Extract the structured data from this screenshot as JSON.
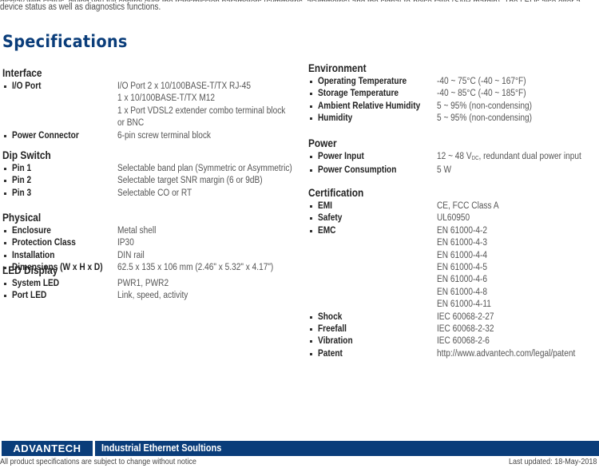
{
  "intro": {
    "line_cut": "display with status, giving you full control over the transmission parameters (symmetric, asymmetric) and the signal-to-noise ratio (SNR margin). The LEDs also offer a quick view of the",
    "line_2": "device status as well as diagnostics functions."
  },
  "title": "Specifications",
  "left_sections": [
    {
      "title": "Interface",
      "rows": [
        {
          "label": "I/O Port",
          "values": [
            "I/O Port 2 x 10/100BASE-T/TX RJ-45",
            "1 x 10/100BASE-T/TX M12",
            "1 x Port VDSL2 extender combo terminal block",
            "or BNC"
          ]
        },
        {
          "label": "Power Connector",
          "values": [
            "6-pin screw terminal block"
          ]
        }
      ]
    },
    {
      "title": "Dip Switch",
      "rows": [
        {
          "label": "Pin 1",
          "values": [
            "Selectable band plan (Symmetric or Asymmetric)"
          ]
        },
        {
          "label": "Pin 2",
          "values": [
            "Selectable target SNR margin (6 or 9dB)"
          ]
        },
        {
          "label": "Pin 3",
          "values": [
            "Selectable CO or RT"
          ]
        }
      ]
    },
    {
      "title": "Physical",
      "rows": [
        {
          "label": "Enclosure",
          "values": [
            "Metal shell"
          ]
        },
        {
          "label": "Protection Class",
          "values": [
            "IP30"
          ]
        },
        {
          "label": "Installation",
          "values": [
            "DIN rail"
          ]
        },
        {
          "label": "Dimensions (W x H x D)",
          "values": [
            "62.5 x 135 x 106 mm (2.46\" x 5.32\" x 4.17\")"
          ]
        }
      ]
    },
    {
      "title": "LED Display",
      "rows": [
        {
          "label": "System LED",
          "values": [
            "PWR1, PWR2"
          ]
        },
        {
          "label": "Port LED",
          "values": [
            "Link, speed, activity"
          ]
        }
      ]
    }
  ],
  "right_sections": [
    {
      "title": "Environment",
      "rows": [
        {
          "label": "Operating Temperature",
          "values": [
            "-40 ~ 75°C (-40 ~ 167°F)"
          ]
        },
        {
          "label": "Storage Temperature",
          "values": [
            "-40 ~ 85°C (-40 ~ 185°F)"
          ]
        },
        {
          "label": "Ambient Relative Humidity",
          "values": [
            "5 ~ 95% (non-condensing)"
          ]
        },
        {
          "label": "Humidity",
          "values": [
            "5 ~ 95% (non-condensing)"
          ]
        }
      ]
    },
    {
      "title": "Power",
      "rows": [
        {
          "label": "Power Input",
          "values": [
            "12 ~ 48 V",
            "DC",
            ", redundant dual power input"
          ],
          "has_subscript": true
        },
        {
          "label": "Power Consumption",
          "values": [
            "5 W"
          ]
        }
      ]
    },
    {
      "title": "Certification",
      "rows": [
        {
          "label": "EMI",
          "values": [
            "CE, FCC Class A"
          ]
        },
        {
          "label": "Safety",
          "values": [
            "UL60950"
          ]
        },
        {
          "label": "EMC",
          "values": [
            "EN 61000-4-2",
            "EN 61000-4-3",
            "EN 61000-4-4",
            "EN 61000-4-5",
            "EN 61000-4-6",
            "EN 61000-4-8",
            "EN 61000-4-11"
          ]
        },
        {
          "label": "Shock",
          "values": [
            "IEC 60068-2-27"
          ]
        },
        {
          "label": "Freefall",
          "values": [
            "IEC 60068-2-32"
          ]
        },
        {
          "label": "Vibration",
          "values": [
            "IEC 60068-2-6"
          ]
        },
        {
          "label": "Patent",
          "values": [
            "http://www.advantech.com/legal/patent"
          ]
        }
      ]
    }
  ],
  "footer": {
    "logo": "ADVANTECH",
    "banner": "Industrial Ethernet Soultions",
    "disclaimer": "All product specifications are subject to change without notice",
    "last_updated": "Last updated: 18-May-2018"
  },
  "colors": {
    "brand_blue": "#0a3d7a"
  }
}
